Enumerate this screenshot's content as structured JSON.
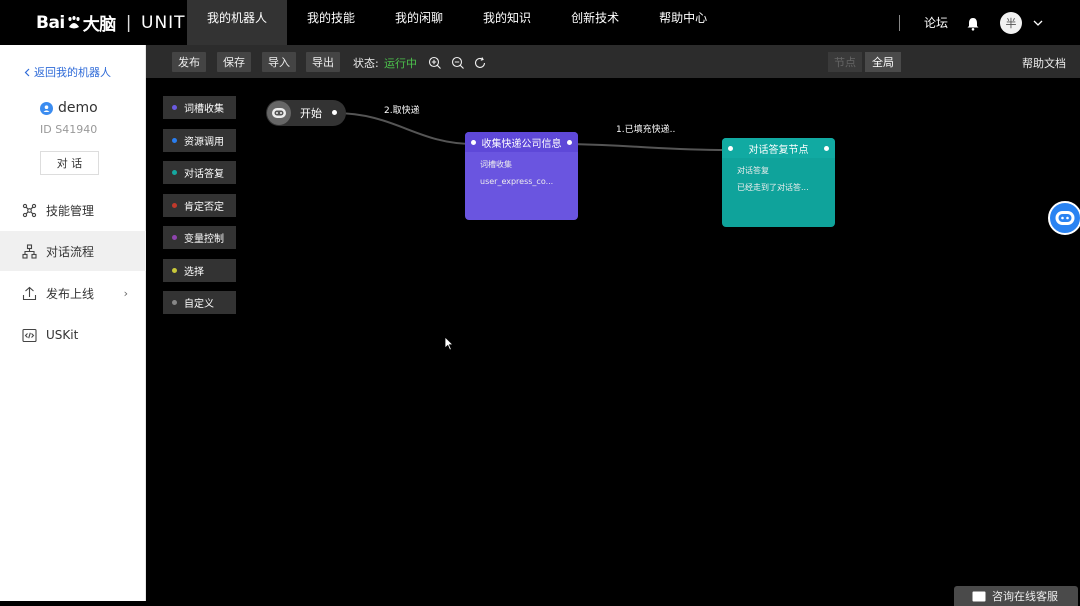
{
  "header": {
    "logo": {
      "brand": "Baié¸å¤§è",
      "product": "UNIT"
    },
    "nav": [
      {
        "label": "我的机器人",
        "active": true
      },
      {
        "label": "我的技能",
        "active": false
      },
      {
        "label": "我的闲聊",
        "active": false
      },
      {
        "label": "我的知识",
        "active": false
      },
      {
        "label": "创新技术",
        "active": false
      },
      {
        "label": "帮助中心",
        "active": false
      }
    ],
    "forum": "论坛",
    "avatar_text": "半",
    "bell_icon": "bell-icon"
  },
  "sidebar": {
    "back": "返回我的机器人",
    "bot_name": "demo",
    "bot_id": "ID S41940",
    "talk": "对 话",
    "items": [
      {
        "label": "技能管理",
        "icon": "skill-graph-icon"
      },
      {
        "label": "对话流程",
        "icon": "flow-tree-icon",
        "active": true
      },
      {
        "label": "发布上线",
        "icon": "upload-icon",
        "arrow": "›"
      },
      {
        "label": "USKit",
        "icon": "code-icon"
      }
    ]
  },
  "toolbar": {
    "publish": "发布",
    "save": "保存",
    "import": "导入",
    "export": "导出",
    "status_label": "状态:",
    "status_value": "运行中",
    "status_color": "#4cc24c",
    "view_node": "节点",
    "view_global": "全局",
    "help_doc": "帮助文档"
  },
  "palette": [
    {
      "label": "词槽收集",
      "color": "#6a5ae0"
    },
    {
      "label": "资源调用",
      "color": "#2a7ef0"
    },
    {
      "label": "对话答复",
      "color": "#15a8a0"
    },
    {
      "label": "肯定否定",
      "color": "#c0392b"
    },
    {
      "label": "变量控制",
      "color": "#8e44ad"
    },
    {
      "label": "选择",
      "color": "#c8c83a"
    },
    {
      "label": "自定义",
      "color": "#888888"
    }
  ],
  "flow": {
    "start": {
      "label": "开始"
    },
    "edge1_label": "2.取快递",
    "edge2_label": "1.已填充快递..",
    "node_collect": {
      "title": "收集快递公司信息",
      "type": "词槽收集",
      "value": "user_express_co...",
      "color": "#6a55e0"
    },
    "node_reply": {
      "title": "对话答复节点",
      "type": "对话答复",
      "value": "已经走到了对话答...",
      "color": "#0fa39b"
    }
  },
  "consult": "咨询在线客服"
}
